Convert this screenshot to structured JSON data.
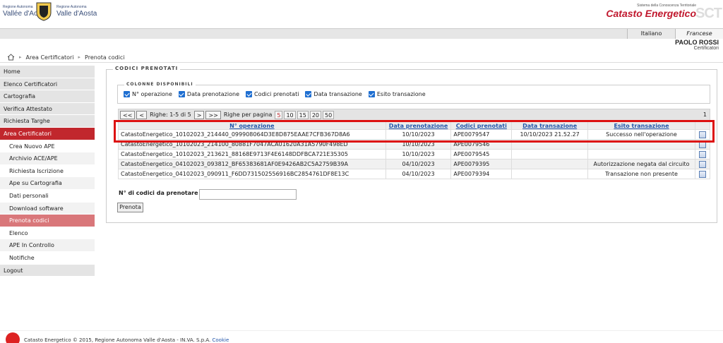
{
  "header": {
    "region_small_1": "Regione Autonoma",
    "region_name_1": "Vallée d'Aoste",
    "region_small_2": "Regione Autonoma",
    "region_name_2": "Valle d'Aosta",
    "system_name": "Sistema della Conoscenza Territoriale",
    "app_title": "Catasto Energetico",
    "app_mark": "SCT",
    "colors": {
      "brand_red": "#c1272d",
      "link_blue": "#2255aa"
    }
  },
  "languages": [
    "Italiano",
    "Francese"
  ],
  "user": {
    "name": "PAOLO ROSSI",
    "role": "Certificatori"
  },
  "breadcrumb": {
    "home_icon": "home-icon",
    "items": [
      "Area Certificatori",
      "Prenota codici"
    ]
  },
  "sidebar": {
    "items": [
      {
        "label": "Home",
        "type": "main"
      },
      {
        "label": "Elenco Certificatori",
        "type": "main"
      },
      {
        "label": "Cartografia",
        "type": "main"
      },
      {
        "label": "Verifica Attestato",
        "type": "main"
      },
      {
        "label": "Richiesta Targhe",
        "type": "main"
      },
      {
        "label": "Area Certificatori",
        "type": "active"
      },
      {
        "label": "Crea Nuovo APE",
        "type": "sub"
      },
      {
        "label": "Archivio ACE/APE",
        "type": "sub"
      },
      {
        "label": "Richiesta Iscrizione",
        "type": "sub"
      },
      {
        "label": "Ape su Cartografia",
        "type": "sub"
      },
      {
        "label": "Dati personali",
        "type": "sub"
      },
      {
        "label": "Download software",
        "type": "sub"
      },
      {
        "label": "Prenota codici",
        "type": "sel"
      },
      {
        "label": "Elenco",
        "type": "sub"
      },
      {
        "label": "APE In Controllo",
        "type": "sub"
      },
      {
        "label": "Notifiche",
        "type": "sub"
      },
      {
        "label": "Logout",
        "type": "main"
      }
    ]
  },
  "main": {
    "section_title": "Codici prenotati",
    "columns_title": "Colonne disponibili",
    "column_toggles": [
      "N° operazione",
      "Data prenotazione",
      "Codici prenotati",
      "Data transazione",
      "Esito transazione"
    ],
    "pager": {
      "first": "<<",
      "prev": "<",
      "info": "Righe: 1-5 di 5",
      "next": ">",
      "last": ">>",
      "per_page_label": "Righe per pagina",
      "sizes": [
        "5",
        "10",
        "15",
        "20",
        "50"
      ],
      "current_size": "5",
      "page": "1"
    },
    "table": {
      "headers": [
        "N° operazione",
        "Data prenotazione",
        "Codici prenotati",
        "Data transazione",
        "Esito transazione"
      ],
      "rows": [
        [
          "CatastoEnergetico_10102023_214440_099908064D3E8D875EAAE7CFB367D8A6",
          "10/10/2023",
          "APE0079547",
          "10/10/2023 21.52.27",
          "Successo nell'operazione"
        ],
        [
          "CatastoEnergetico_10102023_214100_80881F7047ACA01620A31A5790F498ED",
          "10/10/2023",
          "APE0079546",
          "",
          ""
        ],
        [
          "CatastoEnergetico_10102023_213621_88168E9713F4E6148DDFBCA721E35305",
          "10/10/2023",
          "APE0079545",
          "",
          ""
        ],
        [
          "CatastoEnergetico_04102023_093812_BF65383681AF0E9426AB2C5A2759B39A",
          "04/10/2023",
          "APE0079395",
          "",
          "Autorizzazione negata dal circuito"
        ],
        [
          "CatastoEnergetico_04102023_090911_F6DD731502556916BC2854761DF8E13C",
          "04/10/2023",
          "APE0079394",
          "",
          "Transazione non presente"
        ]
      ]
    },
    "reserve_label": "N° di codici da prenotare",
    "reserve_value": "",
    "reserve_button": "Prenota"
  },
  "footer": {
    "text": "Catasto Energetico © 2015, Regione Autonoma Valle d'Aosta - IN.VA. S.p.A.",
    "cookie_link": "Cookie"
  }
}
